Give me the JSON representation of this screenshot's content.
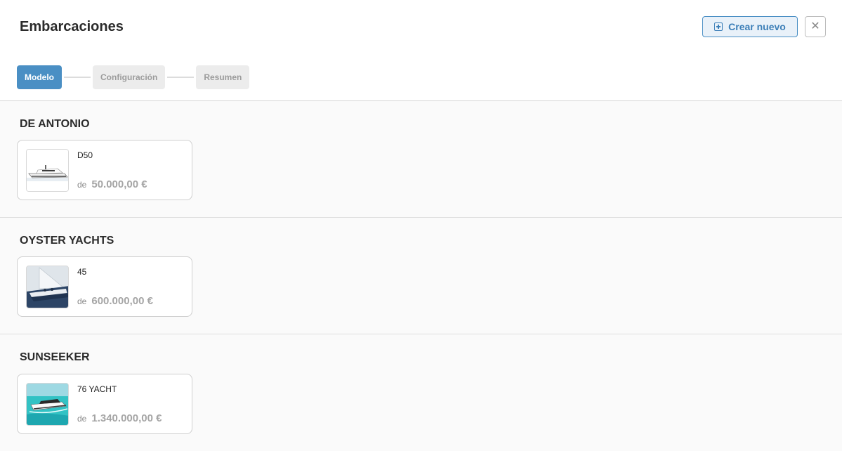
{
  "header": {
    "title": "Embarcaciones",
    "create_label": "Crear nuevo",
    "close_icon": "close-icon"
  },
  "steps": [
    {
      "label": "Modelo",
      "active": true
    },
    {
      "label": "Configuración",
      "active": false
    },
    {
      "label": "Resumen",
      "active": false
    }
  ],
  "brands": [
    {
      "name": "DE ANTONIO",
      "models": [
        {
          "name": "D50",
          "price_prefix": "de",
          "price": "50.000,00 €"
        }
      ]
    },
    {
      "name": "OYSTER YACHTS",
      "models": [
        {
          "name": "45",
          "price_prefix": "de",
          "price": "600.000,00 €"
        }
      ]
    },
    {
      "name": "SUNSEEKER",
      "models": [
        {
          "name": "76 YACHT",
          "price_prefix": "de",
          "price": "1.340.000,00 €"
        }
      ]
    }
  ],
  "colors": {
    "accent": "#4a8fc4",
    "accent_bg": "#e9f1f9",
    "step_inactive_bg": "#ececec",
    "price_text": "#a5a5a5"
  }
}
